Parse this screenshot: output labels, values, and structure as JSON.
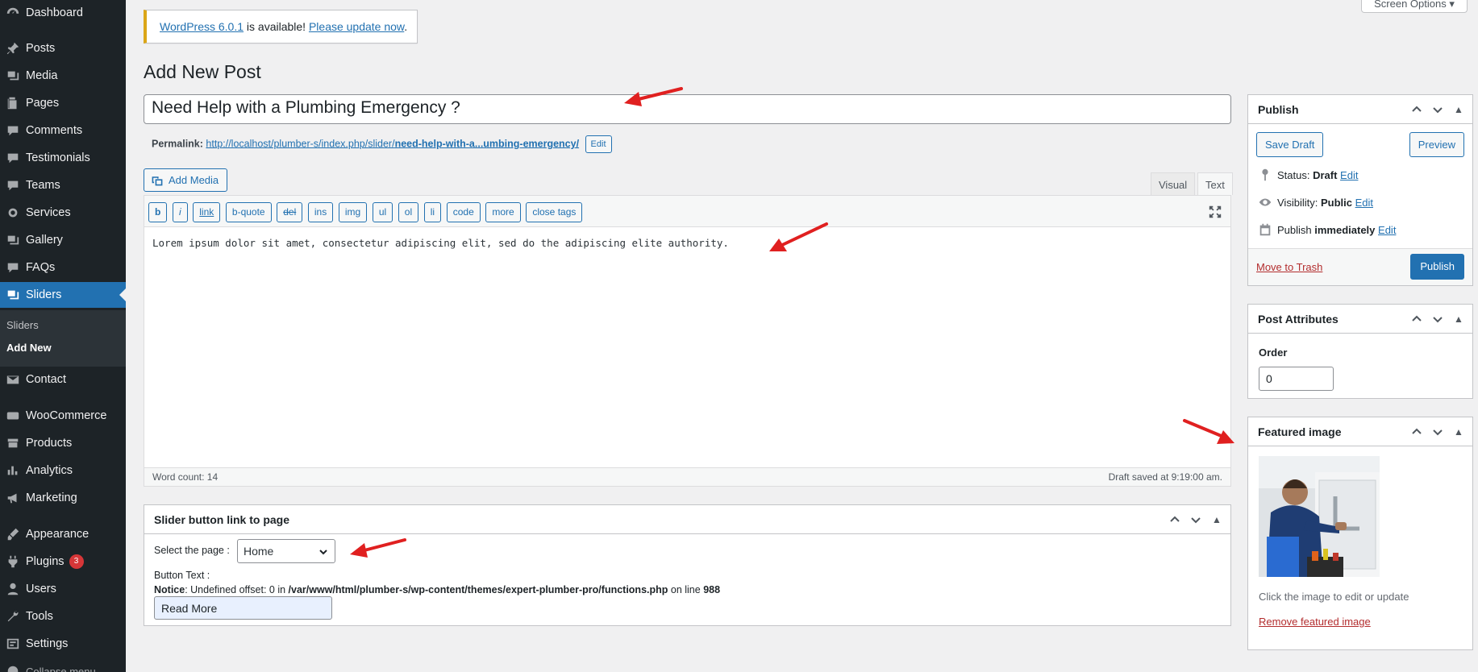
{
  "sidebar": {
    "items": [
      {
        "label": "Dashboard",
        "icon": "dashboard-icon"
      },
      {
        "label": "Posts",
        "icon": "pin-icon"
      },
      {
        "label": "Media",
        "icon": "media-icon"
      },
      {
        "label": "Pages",
        "icon": "pages-icon"
      },
      {
        "label": "Comments",
        "icon": "comments-icon"
      },
      {
        "label": "Testimonials",
        "icon": "testimonials-icon"
      },
      {
        "label": "Teams",
        "icon": "teams-icon"
      },
      {
        "label": "Services",
        "icon": "services-icon"
      },
      {
        "label": "Gallery",
        "icon": "gallery-icon"
      },
      {
        "label": "FAQs",
        "icon": "faqs-icon"
      },
      {
        "label": "Sliders",
        "icon": "sliders-icon"
      },
      {
        "label": "Contact",
        "icon": "envelope-icon"
      },
      {
        "label": "WooCommerce",
        "icon": "woocommerce-icon"
      },
      {
        "label": "Products",
        "icon": "products-icon"
      },
      {
        "label": "Analytics",
        "icon": "analytics-icon"
      },
      {
        "label": "Marketing",
        "icon": "megaphone-icon"
      },
      {
        "label": "Appearance",
        "icon": "brush-icon"
      },
      {
        "label": "Plugins",
        "icon": "plugin-icon",
        "badge": "3"
      },
      {
        "label": "Users",
        "icon": "user-icon"
      },
      {
        "label": "Tools",
        "icon": "wrench-icon"
      },
      {
        "label": "Settings",
        "icon": "settings-icon"
      },
      {
        "label": "Collapse menu",
        "icon": "collapse-icon"
      }
    ],
    "submenu": [
      "Sliders",
      "Add New"
    ]
  },
  "notice": {
    "version_link": "WordPress 6.0.1",
    "middle_text": " is available! ",
    "update_link": "Please update now",
    "end": "."
  },
  "screen_options": "Screen Options ▾",
  "page_title": "Add New Post",
  "post_title": "Need Help with a Plumbing Emergency ?",
  "permalink": {
    "label": "Permalink:",
    "url_base": "http://localhost/plumber-s/index.php/slider/",
    "url_slug": "need-help-with-a...umbing-emergency/",
    "edit": "Edit"
  },
  "add_media": "Add Media",
  "editor_tabs": [
    "Visual",
    "Text"
  ],
  "quicktags": [
    "b",
    "i",
    "link",
    "b-quote",
    "del",
    "ins",
    "img",
    "ul",
    "ol",
    "li",
    "code",
    "more",
    "close tags"
  ],
  "content": "Lorem ipsum dolor sit amet, consectetur adipiscing elit, sed do the adipiscing elite authority.",
  "word_count": "Word count: 14",
  "draft_saved": "Draft saved at 9:19:00 am.",
  "slider_box": {
    "title": "Slider button link to page",
    "select_label": "Select the page :",
    "select_value": "Home",
    "button_text_label": "Button Text :",
    "notice_label": "Notice",
    "notice_text": ": Undefined offset: 0 in ",
    "notice_path": "/var/www/html/plumber-s/wp-content/themes/expert-plumber-pro/functions.php",
    "notice_on": " on line ",
    "notice_line": "988",
    "button_value": "Read More"
  },
  "publish": {
    "title": "Publish",
    "save_draft": "Save Draft",
    "preview": "Preview",
    "status_label": "Status: ",
    "status_value": "Draft",
    "visibility_label": "Visibility: ",
    "visibility_value": "Public",
    "publish_label": "Publish ",
    "publish_value": "immediately",
    "edit": "Edit",
    "trash": "Move to Trash",
    "publish_button": "Publish"
  },
  "attributes": {
    "title": "Post Attributes",
    "order_label": "Order",
    "order_value": "0"
  },
  "featured": {
    "title": "Featured image",
    "hint": "Click the image to edit or update",
    "remove": "Remove featured image"
  },
  "colors": {
    "sidebar_bg": "#1d2327",
    "accent": "#2271b1",
    "arrow": "#e02020"
  }
}
